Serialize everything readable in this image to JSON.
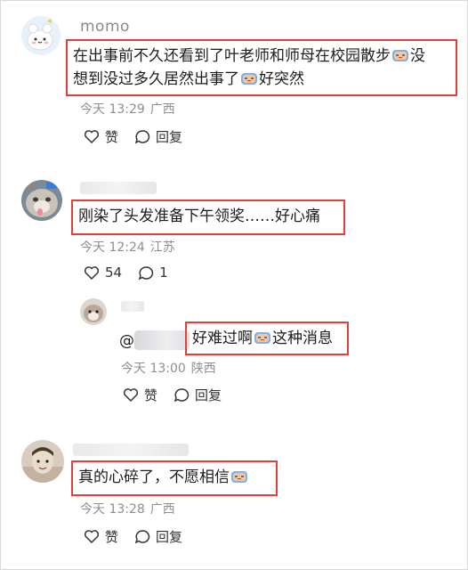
{
  "comments": [
    {
      "name": "momo",
      "text_line1": "在出事前不久还看到了叶老师和师母在校园散步",
      "text_line1_tail": "没",
      "text_line2": "想到没过多久居然出事了",
      "text_line2_tail": "好突然",
      "time": "今天 13:29",
      "location": "广西",
      "like_label": "赞",
      "reply_label": "回复"
    },
    {
      "text": "刚染了头发准备下午领奖……好心痛",
      "time": "今天 12:24",
      "location": "江苏",
      "like_count": "54",
      "reply_count": "1"
    },
    {
      "mention_prefix": "@",
      "text_a": "好难过啊",
      "text_b": "这种消息",
      "time": "今天 13:00",
      "location": "陕西",
      "like_label": "赞",
      "reply_label": "回复"
    },
    {
      "text": "真的心碎了，不愿相信",
      "time": "今天 13:28",
      "location": "广西",
      "like_label": "赞",
      "reply_label": "回复"
    }
  ],
  "colors": {
    "highlight_border": "#e0413b",
    "meta_text": "#8f8f8f"
  },
  "icons": [
    "heart-outline-icon",
    "comment-bubble-icon",
    "crying-emoji-icon"
  ]
}
